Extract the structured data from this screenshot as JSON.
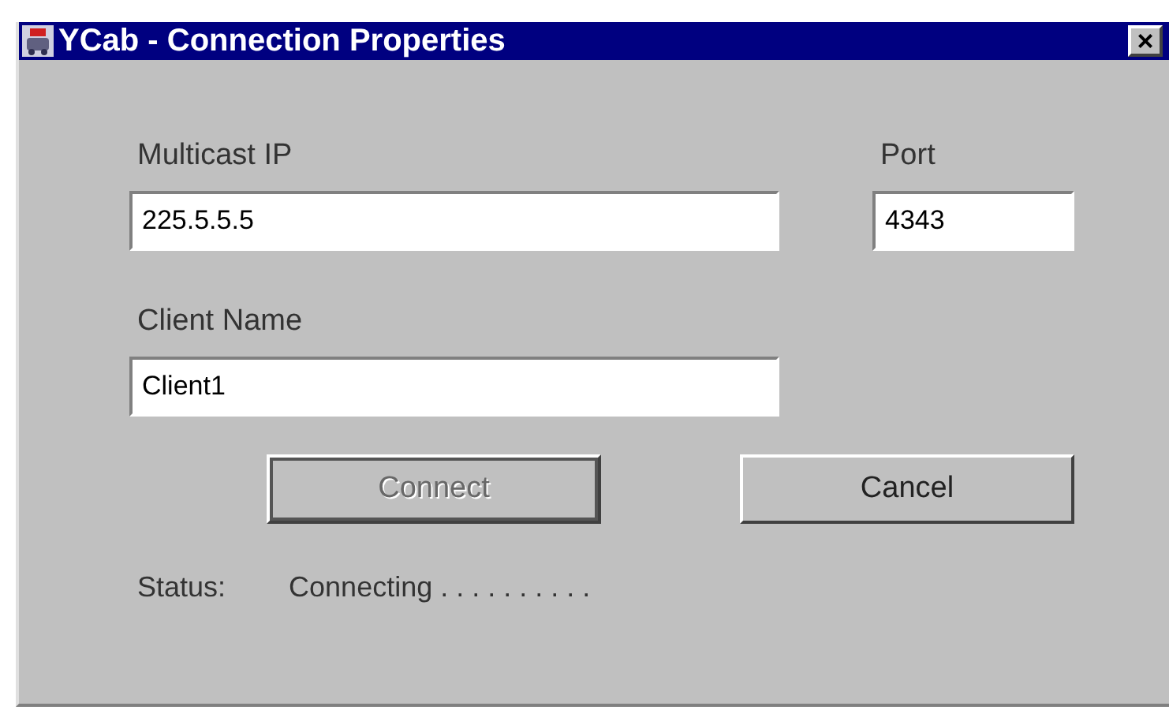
{
  "window": {
    "title": "YCab - Connection Properties",
    "close": "×"
  },
  "fields": [
    {
      "label": "Multicast IP",
      "value": "225.5.5.5"
    },
    {
      "label": "Port",
      "value": "4343"
    },
    {
      "label": "Client Name",
      "value": "Client1"
    }
  ],
  "buttons": [
    {
      "label": "Connect",
      "disabled": true
    },
    {
      "label": "Cancel",
      "disabled": false
    }
  ],
  "status": {
    "label": "Status:",
    "value": "Connecting . . . . . . . . . ."
  }
}
